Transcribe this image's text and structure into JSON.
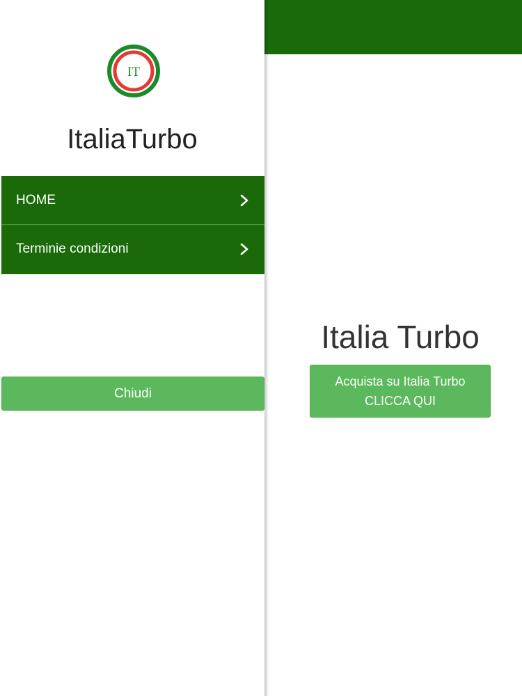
{
  "colors": {
    "brand_green": "#1b6a09",
    "button_green": "#5cb85c",
    "logo_red": "#e53935",
    "logo_green": "#1b8a2a"
  },
  "drawer": {
    "logo_text": "IT",
    "brand_title": "ItaliaTurbo",
    "menu": [
      {
        "label": "HOME",
        "icon": "chevron-right-icon"
      },
      {
        "label": "Terminie condizioni",
        "icon": "chevron-right-icon"
      }
    ],
    "close_label": "Chiudi"
  },
  "main": {
    "title": "Italia Turbo",
    "buy_button": {
      "line1": "Acquista su Italia Turbo",
      "line2": "CLICCA QUI"
    }
  }
}
